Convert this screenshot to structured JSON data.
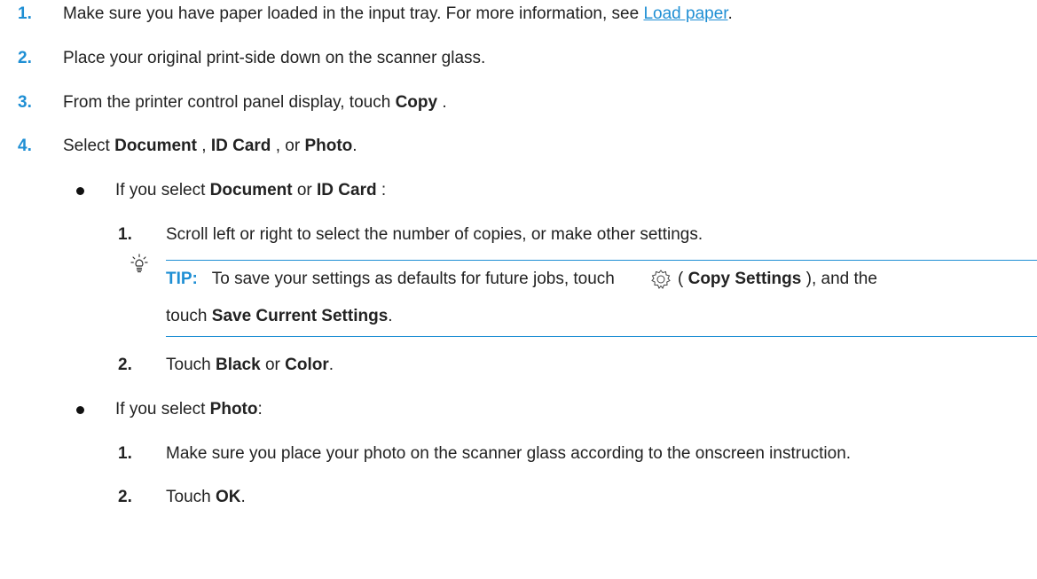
{
  "steps": [
    {
      "number": "1.",
      "text_before": "Make sure you have paper loaded in the input tray. For more information, see ",
      "link_text": "Load paper",
      "text_after": "."
    },
    {
      "number": "2.",
      "text": "Place your original print-side down on the scanner glass."
    },
    {
      "number": "3.",
      "text_before": "From the printer control panel display, touch ",
      "bold": "Copy",
      "text_after": " ."
    },
    {
      "number": "4.",
      "text_before": "Select ",
      "bold1": "Document",
      "mid1": " , ",
      "bold2": "ID Card",
      "mid2": " , or ",
      "bold3": "Photo",
      "text_after": "."
    }
  ],
  "bullet_document": {
    "text_before": "If you select ",
    "bold1": "Document",
    "mid": " or ",
    "bold2": "ID Card",
    "text_after": " :",
    "substeps": [
      {
        "number": "1.",
        "text": "Scroll left or right to select the number of copies, or make other settings."
      },
      {
        "number": "2.",
        "text_before": "Touch ",
        "bold1": "Black",
        "mid": " or ",
        "bold2": "Color",
        "text_after": "."
      }
    ],
    "tip": {
      "label": "TIP:",
      "line1_before": "To save your settings as defaults for future jobs, touch",
      "line1_paren_open": " ( ",
      "line1_bold": "Copy Settings",
      "line1_after": " ), and the",
      "line2_before": "touch ",
      "line2_bold": "Save Current Settings",
      "line2_after": "."
    }
  },
  "bullet_photo": {
    "text_before": "If you select ",
    "bold": "Photo",
    "text_after": ":",
    "substeps": [
      {
        "number": "1.",
        "text": "Make sure you place your photo on the scanner glass according to the onscreen instruction."
      },
      {
        "number": "2.",
        "text_before": "Touch ",
        "bold": "OK",
        "text_after": "."
      }
    ]
  },
  "colors": {
    "accent": "#1f8fd4",
    "text": "#222222"
  },
  "icons": [
    "lightbulb-icon",
    "gear-icon"
  ]
}
